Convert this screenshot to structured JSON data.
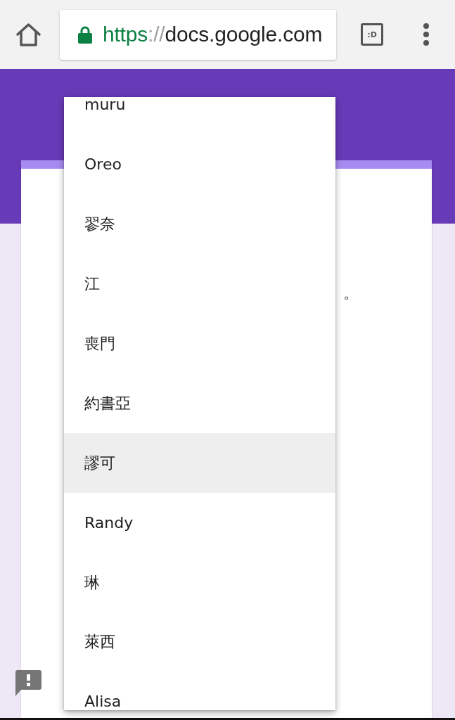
{
  "browser": {
    "url": {
      "scheme": "https",
      "separator": "://",
      "host": "docs.google.com"
    },
    "tab_switcher_label": ":D"
  },
  "form": {
    "description_fragment": "。"
  },
  "dropdown": {
    "options": [
      {
        "label": "muru",
        "selected": false
      },
      {
        "label": "Oreo",
        "selected": false
      },
      {
        "label": "翏奈",
        "selected": false
      },
      {
        "label": "江",
        "selected": false
      },
      {
        "label": "喪門",
        "selected": false
      },
      {
        "label": "約書亞",
        "selected": false
      },
      {
        "label": "謬可",
        "selected": true
      },
      {
        "label": "Randy",
        "selected": false
      },
      {
        "label": "琳",
        "selected": false
      },
      {
        "label": "萊西",
        "selected": false
      },
      {
        "label": "Alisa",
        "selected": false
      }
    ]
  }
}
